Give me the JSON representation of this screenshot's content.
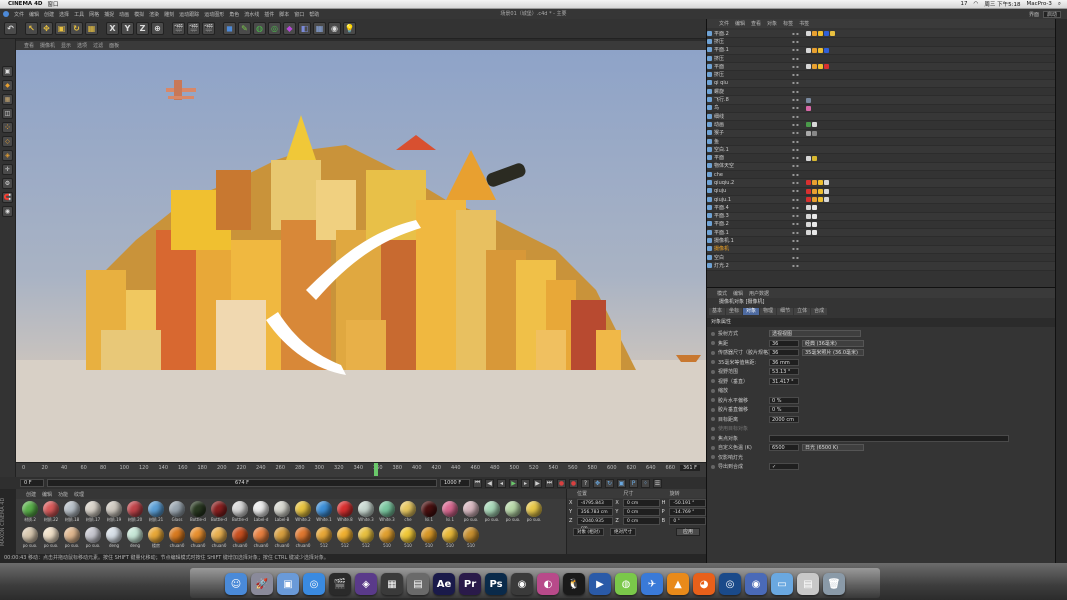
{
  "menubar": {
    "app_name": "CINEMA 4D",
    "menu": "窗口",
    "status_right": [
      "17",
      "周三 下午5:18",
      "MacPro-3"
    ]
  },
  "window": {
    "title": "场景01（城堡）.c4d * - 主要"
  },
  "c4d_menu": [
    "文件",
    "编辑",
    "创建",
    "选择",
    "工具",
    "网格",
    "捕捉",
    "动画",
    "模拟",
    "渲染",
    "雕刻",
    "运动跟踪",
    "运动图形",
    "角色",
    "流水线",
    "插件",
    "脚本",
    "窗口",
    "帮助"
  ],
  "layout": {
    "label": "界面",
    "value": "启动"
  },
  "toolbar": {
    "undo": "↶",
    "axes": [
      "X",
      "Y",
      "Z"
    ],
    "redo": "↷"
  },
  "viewport_menu": [
    "查看",
    "摄像机",
    "显示",
    "选项",
    "过滤",
    "面板"
  ],
  "timeline": {
    "ticks": [
      "0",
      "20",
      "40",
      "60",
      "80",
      "100",
      "120",
      "140",
      "160",
      "180",
      "200",
      "220",
      "240",
      "260",
      "280",
      "300",
      "320",
      "340",
      "360",
      "380",
      "400",
      "420",
      "440",
      "460",
      "480",
      "500",
      "520",
      "540",
      "560",
      "580",
      "600",
      "620",
      "640",
      "660",
      "680"
    ],
    "current_frame_label": "361 F",
    "playhead_frame": 361,
    "start_field": "0 F",
    "end_field": "1000 F",
    "range_value": "674 F"
  },
  "materials": {
    "menu": [
      "创建",
      "编辑",
      "功能",
      "纹理"
    ],
    "items": [
      {
        "label": "材质.2",
        "color": "#5ab04a"
      },
      {
        "label": "材质.22",
        "color": "#d85a5a"
      },
      {
        "label": "材质.18",
        "color": "#b8c0c8"
      },
      {
        "label": "材质.17",
        "color": "#d8d2c8"
      },
      {
        "label": "材质.19",
        "color": "#cfc9c0"
      },
      {
        "label": "材质.20",
        "color": "#c0444a"
      },
      {
        "label": "材质.21",
        "color": "#5b9fd6"
      },
      {
        "label": "Glass",
        "color": "#9aa6b0"
      },
      {
        "label": "Bottle-d",
        "color": "#2a3a22"
      },
      {
        "label": "Bottle-d",
        "color": "#8a2020"
      },
      {
        "label": "Bottle-d",
        "color": "#d8d8d8"
      },
      {
        "label": "Label-d",
        "color": "#eeeeee"
      },
      {
        "label": "Label-B",
        "color": "#d8d8d0"
      },
      {
        "label": "White.2",
        "color": "#e8c440"
      },
      {
        "label": "White.1",
        "color": "#3d8fd8"
      },
      {
        "label": "White.8",
        "color": "#d83030"
      },
      {
        "label": "White.3",
        "color": "#c8d8d0"
      },
      {
        "label": "White.3",
        "color": "#7ac8a0"
      },
      {
        "label": "che",
        "color": "#e8c860"
      },
      {
        "label": "lsi.1",
        "color": "#4a1010"
      },
      {
        "label": "lsi.1",
        "color": "#d86890"
      },
      {
        "label": "po suo.",
        "color": "#d8b8c0"
      },
      {
        "label": "po suo.",
        "color": "#a8d8b8"
      },
      {
        "label": "po suo.",
        "color": "#b8d8a8"
      },
      {
        "label": "po suo.",
        "color": "#e8c848"
      },
      {
        "label": "po suo.",
        "color": "#d8c8b0"
      },
      {
        "label": "po suo.",
        "color": "#f0e0c8"
      },
      {
        "label": "po suo.",
        "color": "#e0b890"
      },
      {
        "label": "po suo.",
        "color": "#c8c8d0"
      },
      {
        "label": "deng",
        "color": "#d8e0e8"
      },
      {
        "label": "deng",
        "color": "#c8e8d8"
      },
      {
        "label": "楼房",
        "color": "#e8a838"
      },
      {
        "label": "chuan0",
        "color": "#d87a20"
      },
      {
        "label": "chuan0",
        "color": "#e89030"
      },
      {
        "label": "chuan0",
        "color": "#e8b050"
      },
      {
        "label": "chuan0",
        "color": "#c85020"
      },
      {
        "label": "chuan0",
        "color": "#e88040"
      },
      {
        "label": "chuan0",
        "color": "#d8a040"
      },
      {
        "label": "chuan0",
        "color": "#e07830"
      },
      {
        "label": "512",
        "color": "#e8a838"
      },
      {
        "label": "512",
        "color": "#f0b030"
      },
      {
        "label": "512",
        "color": "#e8c040"
      },
      {
        "label": "510",
        "color": "#e0a030"
      },
      {
        "label": "510",
        "color": "#f0c838"
      },
      {
        "label": "510",
        "color": "#d89828"
      },
      {
        "label": "510",
        "color": "#e8b838"
      },
      {
        "label": "510",
        "color": "#c89030"
      }
    ]
  },
  "maxon_label": "MAXON CINEMA 4D",
  "coordinates": {
    "headers": [
      "位置",
      "尺寸",
      "旋转"
    ],
    "rows": [
      {
        "axis": "X",
        "pos": "-4795.843 cm",
        "axis2": "X",
        "size": "0 cm",
        "rot_axis": "H",
        "rot": "-50.191 °"
      },
      {
        "axis": "Y",
        "pos": "356.783 cm",
        "axis2": "Y",
        "size": "0 cm",
        "rot_axis": "P",
        "rot": "-14.769 °"
      },
      {
        "axis": "Z",
        "pos": "-2040.935 cm",
        "axis2": "Z",
        "size": "0 cm",
        "rot_axis": "B",
        "rot": "0 °"
      }
    ],
    "mode1": "对象 (相对)",
    "mode2": "绝对尺寸",
    "apply": "应用"
  },
  "status_bar": "00:00:43   移动：点击并拖动鼠标移动元素。按住 SHIFT 键量化移动；节点编辑模式时按住 SHIFT 键增加选择对象；按住 CTRL 键减少选择对象。",
  "object_manager": {
    "menu": [
      "文件",
      "编辑",
      "查看",
      "对象",
      "标签",
      "书签"
    ],
    "items": [
      {
        "name": "平面.2",
        "tags": [
          "#d8d8d8",
          "#e8a030",
          "#f0c030",
          "#3060d8",
          "#e8c040"
        ]
      },
      {
        "name": "挤压",
        "tags": []
      },
      {
        "name": "平面.1",
        "tags": [
          "#d8d8d8",
          "#e8a030",
          "#f0c030",
          "#3060d8"
        ]
      },
      {
        "name": "挤压",
        "tags": []
      },
      {
        "name": "平面",
        "tags": [
          "#d8d8d8",
          "#e8a030",
          "#f0c030",
          "#d83030"
        ]
      },
      {
        "name": "挤压",
        "tags": []
      },
      {
        "name": "qi qiu",
        "tags": []
      },
      {
        "name": "螺旋",
        "tags": []
      },
      {
        "name": "飞行.8",
        "tags": [
          "#7a8aa0"
        ]
      },
      {
        "name": "鸟",
        "tags": [
          "#d868a8"
        ]
      },
      {
        "name": "细线",
        "tags": []
      },
      {
        "name": "动画",
        "tags": [
          "#4a9a4a",
          "#d8d8d8"
        ]
      },
      {
        "name": "猴子",
        "tags": [
          "#aaaaaa",
          "#888888"
        ]
      },
      {
        "name": "鱼",
        "tags": []
      },
      {
        "name": "空白.1",
        "tags": []
      },
      {
        "name": "平面",
        "tags": [
          "#d8d8d8",
          "#d8b830"
        ]
      },
      {
        "name": "物体天空",
        "tags": []
      },
      {
        "name": "che",
        "tags": []
      },
      {
        "name": "qiuqiu.2",
        "tags": [
          "#d83030",
          "#e8a030",
          "#f0c030",
          "#d8d8d8"
        ]
      },
      {
        "name": "qiuju",
        "tags": [
          "#d83030",
          "#e8a030",
          "#f0c030",
          "#d8d8d8"
        ]
      },
      {
        "name": "qiuju.1",
        "tags": [
          "#d83030",
          "#e8a030",
          "#f0c030",
          "#d8d8d8"
        ]
      },
      {
        "name": "平面.4",
        "tags": [
          "#d8d8d8",
          "#e8e8e8"
        ]
      },
      {
        "name": "平面.3",
        "tags": [
          "#d8d8d8",
          "#e8e8e8"
        ]
      },
      {
        "name": "平面.2",
        "tags": [
          "#d8d8d8",
          "#e8e8e8"
        ]
      },
      {
        "name": "平面.1",
        "tags": [
          "#d8d8d8",
          "#e8e8e8"
        ]
      },
      {
        "name": "摄像机.1",
        "tags": []
      },
      {
        "name": "摄像机",
        "tags": [],
        "selected": true
      },
      {
        "name": "空白",
        "tags": []
      },
      {
        "name": "灯光.2",
        "tags": []
      }
    ]
  },
  "attributes": {
    "menu": [
      "模式",
      "编辑",
      "用户数据"
    ],
    "title": "摄像机对象 [摄像机]",
    "tabs": [
      {
        "label": "基本",
        "active": false
      },
      {
        "label": "坐标",
        "active": false
      },
      {
        "label": "对象",
        "active": true
      },
      {
        "label": "物理",
        "active": false
      },
      {
        "label": "细节",
        "active": false
      },
      {
        "label": "立体",
        "active": false
      },
      {
        "label": "合成",
        "active": false
      }
    ],
    "section": "对象属性",
    "rows": [
      {
        "label": "投射方式",
        "value": "",
        "select": "透视视图",
        "wide": true
      },
      {
        "label": "焦距",
        "value": "36",
        "select": "经典 (36毫米)"
      },
      {
        "label": "传感器尺寸（胶片规格）",
        "value": "36",
        "select": "35毫米照片 (36.0毫米)"
      },
      {
        "label": "35毫米等值焦距:",
        "value": "36 mm",
        "select": ""
      },
      {
        "label": "视野范围",
        "value": "53.13 °",
        "select": ""
      },
      {
        "label": "视野（垂直）",
        "value": "31.417 °",
        "select": ""
      },
      {
        "label": "缩放",
        "value": "",
        "select": ""
      },
      {
        "label": "胶片水平偏移",
        "value": "0 %",
        "select": ""
      },
      {
        "label": "胶片垂直偏移",
        "value": "0 %",
        "select": ""
      },
      {
        "label": "目标距离",
        "value": "2000 cm",
        "select": ""
      },
      {
        "label": "使用目标对象",
        "value": "",
        "select": "",
        "dim": true
      },
      {
        "label": "焦点对象",
        "value": "",
        "select": "",
        "wide_field": true
      },
      {
        "label": "自定义色温 (K)",
        "value": "6500",
        "select": "日光 (6500 K)"
      },
      {
        "label": "仅影响灯光",
        "value": "",
        "select": ""
      },
      {
        "label": "导出到合成",
        "value": "✓",
        "select": ""
      }
    ]
  },
  "dock": {
    "apps": [
      {
        "name": "finder",
        "color": "#4a8ad8",
        "glyph": "☺"
      },
      {
        "name": "launchpad",
        "color": "#8a8a9a",
        "glyph": "🚀"
      },
      {
        "name": "preview",
        "color": "#6a9ad8",
        "glyph": "▣"
      },
      {
        "name": "safari",
        "color": "#3a8ae0",
        "glyph": "◎"
      },
      {
        "name": "final-cut",
        "color": "#2a2a2a",
        "glyph": "🎬"
      },
      {
        "name": "motion",
        "color": "#5a3a8a",
        "glyph": "◈"
      },
      {
        "name": "compressor",
        "color": "#3a3a3a",
        "glyph": "▦"
      },
      {
        "name": "photo",
        "color": "#6a6a6a",
        "glyph": "▤"
      },
      {
        "name": "after-effects",
        "color": "#1a1a4a",
        "glyph": "Ae"
      },
      {
        "name": "premiere",
        "color": "#2a1a4a",
        "glyph": "Pr"
      },
      {
        "name": "photoshop",
        "color": "#0a2a4a",
        "glyph": "Ps"
      },
      {
        "name": "cinema4d",
        "color": "#3a3a3a",
        "glyph": "◉"
      },
      {
        "name": "color",
        "color": "#b84a8a",
        "glyph": "◐"
      },
      {
        "name": "qq",
        "color": "#1a1a1a",
        "glyph": "🐧"
      },
      {
        "name": "quicktime",
        "color": "#2a5aa8",
        "glyph": "▶"
      },
      {
        "name": "folder-app",
        "color": "#7ac84a",
        "glyph": "◍"
      },
      {
        "name": "plane-app",
        "color": "#3a7ad8",
        "glyph": "✈"
      },
      {
        "name": "vlc",
        "color": "#e88a1a",
        "glyph": "▲"
      },
      {
        "name": "firefox",
        "color": "#e8601a",
        "glyph": "◕"
      },
      {
        "name": "c4d-dock",
        "color": "#1a4a8a",
        "glyph": "◎"
      },
      {
        "name": "steam",
        "color": "#4a6ab8",
        "glyph": "◉"
      },
      {
        "name": "folder",
        "color": "#6aa8e0",
        "glyph": "▭"
      },
      {
        "name": "documents",
        "color": "#c8c8c8",
        "glyph": "▤"
      },
      {
        "name": "trash",
        "color": "#8a9aa8",
        "glyph": "🗑"
      }
    ]
  }
}
